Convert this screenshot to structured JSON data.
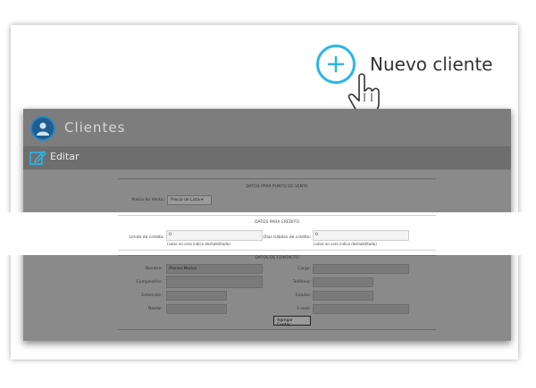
{
  "action": {
    "label": "Nuevo cliente"
  },
  "header": {
    "title": "Clientes"
  },
  "editbar": {
    "label": "Editar"
  },
  "sections": {
    "punto_venta": {
      "title": "DATOS PARA PUNTO DE VENTA",
      "precio_label": "Precio de Venta:",
      "precio_value": "Precio de Lista"
    },
    "credito": {
      "title": "DATOS PARA CRÉDITO",
      "limite_label": "Límite de crédito:",
      "limite_value": "0",
      "limite_hint": "(valor en cero indica deshabilitado)",
      "dias_label": "Días hábiles de crédito:",
      "dias_value": "0",
      "dias_hint": "(valor en cero indica deshabilitado)"
    },
    "contacto": {
      "title": "DATOS DE CONTACTO",
      "nombre_label": "Nombre:",
      "nombre_value": "Alonso Muñoz",
      "cargo_label": "Cargo:",
      "cumpleanos_label": "Cumpleaños:",
      "telefono_label": "Teléfono:",
      "extension_label": "Extensión:",
      "celular_label": "Celular:",
      "nextel_label": "Nextel:",
      "email_label": "E-mail:",
      "add_button": "Agregar Contac"
    }
  },
  "colors": {
    "accent": "#29b6e8",
    "avatar": "#1d5f8f"
  }
}
